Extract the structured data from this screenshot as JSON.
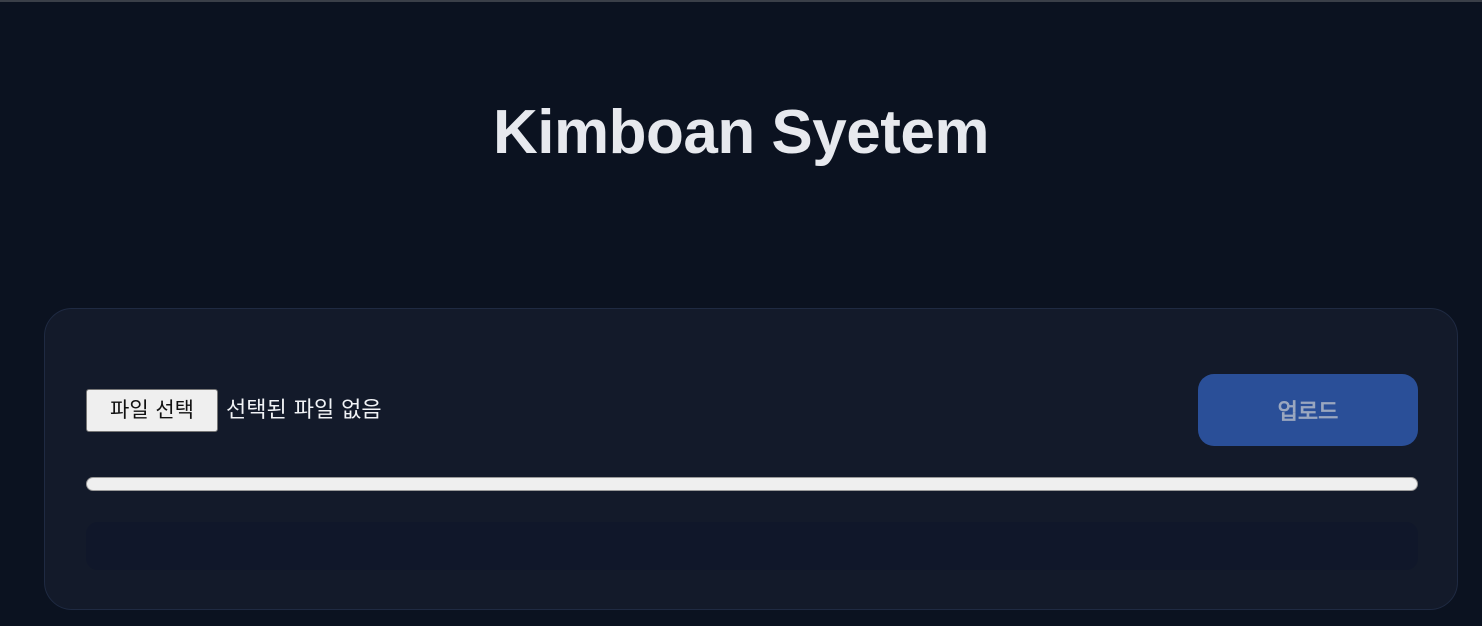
{
  "header": {
    "title": "Kimboan Syetem"
  },
  "uploader": {
    "file_button_label": "파일 선택",
    "file_status": "선택된 파일 없음",
    "upload_button_label": "업로드",
    "upload_enabled": false,
    "progress_percent": 0,
    "result_text": ""
  },
  "colors": {
    "background": "#0b1220",
    "panel": "#131a2a",
    "accent": "#2a4f98"
  }
}
